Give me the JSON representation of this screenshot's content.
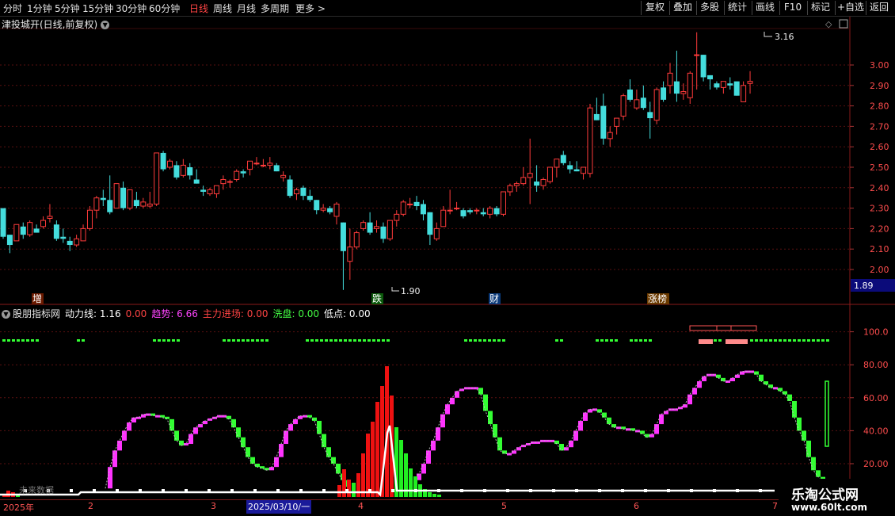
{
  "toolbar": {
    "periods": [
      "分时",
      "1分钟",
      "5分钟",
      "15分钟",
      "30分钟",
      "60分钟",
      "日线",
      "周线",
      "月线",
      "多周期",
      "更多 >"
    ],
    "active_period": "日线",
    "right_buttons": [
      "复权",
      "叠加",
      "多股",
      "统计",
      "画线",
      "F10",
      "标记",
      "+自选",
      "返回"
    ]
  },
  "main_chart": {
    "title": "津投城开(日线,前复权)",
    "y_ticks": [
      "3.00",
      "2.90",
      "2.80",
      "2.70",
      "2.60",
      "2.50",
      "2.40",
      "2.30",
      "2.20",
      "2.10",
      "2.00"
    ],
    "current_price": "1.89",
    "high_label": "3.16",
    "low_label": "1.90",
    "event_markers": [
      "增",
      "跌",
      "财",
      "涨榜"
    ],
    "candles": [
      [
        2.3,
        2.27,
        2.15,
        2.16
      ],
      [
        2.17,
        2.17,
        2.08,
        2.12
      ],
      [
        2.14,
        2.22,
        2.14,
        2.22
      ],
      [
        2.21,
        2.23,
        2.15,
        2.17
      ],
      [
        2.17,
        2.24,
        2.16,
        2.23
      ],
      [
        2.2,
        2.22,
        2.18,
        2.18
      ],
      [
        2.21,
        2.26,
        2.2,
        2.24
      ],
      [
        2.25,
        2.32,
        2.23,
        2.26
      ],
      [
        2.22,
        2.24,
        2.14,
        2.15
      ],
      [
        2.16,
        2.2,
        2.13,
        2.15
      ],
      [
        2.14,
        2.16,
        2.09,
        2.12
      ],
      [
        2.12,
        2.17,
        2.11,
        2.15
      ],
      [
        2.14,
        2.22,
        2.14,
        2.2
      ],
      [
        2.2,
        2.31,
        2.19,
        2.29
      ],
      [
        2.29,
        2.36,
        2.25,
        2.35
      ],
      [
        2.35,
        2.39,
        2.31,
        2.34
      ],
      [
        2.34,
        2.46,
        2.27,
        2.28
      ],
      [
        2.3,
        2.41,
        2.3,
        2.42
      ],
      [
        2.4,
        2.43,
        2.29,
        2.3
      ],
      [
        2.3,
        2.39,
        2.29,
        2.39
      ],
      [
        2.34,
        2.38,
        2.3,
        2.31
      ],
      [
        2.31,
        2.35,
        2.3,
        2.33
      ],
      [
        2.31,
        2.38,
        2.3,
        2.32
      ],
      [
        2.32,
        2.57,
        2.31,
        2.57
      ],
      [
        2.57,
        2.58,
        2.48,
        2.49
      ],
      [
        2.5,
        2.54,
        2.49,
        2.53
      ],
      [
        2.51,
        2.53,
        2.44,
        2.45
      ],
      [
        2.46,
        2.54,
        2.45,
        2.51
      ],
      [
        2.5,
        2.52,
        2.44,
        2.46
      ],
      [
        2.44,
        2.49,
        2.42,
        2.42
      ],
      [
        2.39,
        2.41,
        2.36,
        2.38
      ],
      [
        2.37,
        2.4,
        2.36,
        2.39
      ],
      [
        2.37,
        2.41,
        2.35,
        2.41
      ],
      [
        2.42,
        2.46,
        2.39,
        2.44
      ],
      [
        2.43,
        2.44,
        2.4,
        2.43
      ],
      [
        2.44,
        2.49,
        2.43,
        2.48
      ],
      [
        2.48,
        2.49,
        2.45,
        2.47
      ],
      [
        2.49,
        2.52,
        2.46,
        2.53
      ],
      [
        2.52,
        2.55,
        2.51,
        2.52
      ],
      [
        2.51,
        2.54,
        2.5,
        2.51
      ],
      [
        2.51,
        2.55,
        2.49,
        2.52
      ],
      [
        2.51,
        2.52,
        2.48,
        2.48
      ],
      [
        2.45,
        2.48,
        2.43,
        2.46
      ],
      [
        2.44,
        2.46,
        2.35,
        2.36
      ],
      [
        2.37,
        2.4,
        2.34,
        2.39
      ],
      [
        2.4,
        2.41,
        2.34,
        2.36
      ],
      [
        2.36,
        2.39,
        2.33,
        2.34
      ],
      [
        2.34,
        2.34,
        2.27,
        2.29
      ],
      [
        2.29,
        2.32,
        2.28,
        2.3
      ],
      [
        2.3,
        2.31,
        2.27,
        2.28
      ],
      [
        2.26,
        2.33,
        2.22,
        2.32
      ],
      [
        2.23,
        2.23,
        1.9,
        2.09
      ],
      [
        2.04,
        2.2,
        1.95,
        2.11
      ],
      [
        2.11,
        2.19,
        2.1,
        2.18
      ],
      [
        2.2,
        2.24,
        2.19,
        2.23
      ],
      [
        2.23,
        2.28,
        2.17,
        2.18
      ],
      [
        2.2,
        2.24,
        2.18,
        2.21
      ],
      [
        2.21,
        2.23,
        2.13,
        2.15
      ],
      [
        2.15,
        2.24,
        2.14,
        2.24
      ],
      [
        2.24,
        2.29,
        2.21,
        2.27
      ],
      [
        2.27,
        2.34,
        2.26,
        2.33
      ],
      [
        2.32,
        2.35,
        2.3,
        2.32
      ],
      [
        2.33,
        2.36,
        2.29,
        2.31
      ],
      [
        2.32,
        2.34,
        2.24,
        2.27
      ],
      [
        2.28,
        2.28,
        2.12,
        2.17
      ],
      [
        2.15,
        2.23,
        2.14,
        2.2
      ],
      [
        2.21,
        2.31,
        2.21,
        2.29
      ],
      [
        2.29,
        2.39,
        2.27,
        2.29
      ],
      [
        2.3,
        2.33,
        2.29,
        2.3
      ],
      [
        2.29,
        2.3,
        2.25,
        2.26
      ],
      [
        2.29,
        2.3,
        2.27,
        2.28
      ],
      [
        2.29,
        2.3,
        2.27,
        2.29
      ],
      [
        2.28,
        2.3,
        2.26,
        2.27
      ],
      [
        2.27,
        2.31,
        2.25,
        2.3
      ],
      [
        2.3,
        2.31,
        2.26,
        2.27
      ],
      [
        2.27,
        2.38,
        2.26,
        2.38
      ],
      [
        2.38,
        2.42,
        2.36,
        2.41
      ],
      [
        2.41,
        2.43,
        2.38,
        2.42
      ],
      [
        2.42,
        2.5,
        2.41,
        2.45
      ],
      [
        2.45,
        2.64,
        2.32,
        2.47
      ],
      [
        2.43,
        2.51,
        2.38,
        2.41
      ],
      [
        2.41,
        2.45,
        2.39,
        2.44
      ],
      [
        2.43,
        2.5,
        2.42,
        2.5
      ],
      [
        2.5,
        2.52,
        2.45,
        2.54
      ],
      [
        2.56,
        2.58,
        2.51,
        2.52
      ],
      [
        2.51,
        2.53,
        2.47,
        2.49
      ],
      [
        2.49,
        2.53,
        2.48,
        2.48
      ],
      [
        2.47,
        2.5,
        2.44,
        2.5
      ],
      [
        2.47,
        2.81,
        2.45,
        2.79
      ],
      [
        2.76,
        2.84,
        2.73,
        2.73
      ],
      [
        2.8,
        2.86,
        2.61,
        2.64
      ],
      [
        2.64,
        2.7,
        2.6,
        2.67
      ],
      [
        2.7,
        2.74,
        2.66,
        2.74
      ],
      [
        2.75,
        2.86,
        2.73,
        2.85
      ],
      [
        2.88,
        2.93,
        2.82,
        2.83
      ],
      [
        2.79,
        2.88,
        2.78,
        2.83
      ],
      [
        2.84,
        2.9,
        2.78,
        2.79
      ],
      [
        2.77,
        2.82,
        2.64,
        2.74
      ],
      [
        2.73,
        2.89,
        2.71,
        2.88
      ],
      [
        2.89,
        2.92,
        2.82,
        2.83
      ],
      [
        2.9,
        3.01,
        2.86,
        2.96
      ],
      [
        2.92,
        3.07,
        2.82,
        2.86
      ],
      [
        2.86,
        2.91,
        2.83,
        2.87
      ],
      [
        2.84,
        2.97,
        2.81,
        2.96
      ],
      [
        3.05,
        3.16,
        2.88,
        3.05
      ],
      [
        3.05,
        3.05,
        2.92,
        2.94
      ],
      [
        2.95,
        2.95,
        2.88,
        2.93
      ],
      [
        2.91,
        2.92,
        2.88,
        2.89
      ],
      [
        2.89,
        2.92,
        2.86,
        2.92
      ],
      [
        2.91,
        2.94,
        2.88,
        2.9
      ],
      [
        2.92,
        2.91,
        2.85,
        2.85
      ],
      [
        2.82,
        2.92,
        2.82,
        2.9
      ],
      [
        2.91,
        2.97,
        2.86,
        2.92
      ]
    ]
  },
  "indicator": {
    "name": "股朋指标网",
    "items": [
      {
        "label": "动力线: 1.16",
        "color": "#ffffff"
      },
      {
        "label": "0.00",
        "color": "#ff4444"
      },
      {
        "label": "趋势: 6.66",
        "color": "#ff44ff"
      },
      {
        "label": "主力进场: 0.00",
        "color": "#ff4444"
      },
      {
        "label": "洗盘: 0.00",
        "color": "#44ff44"
      },
      {
        "label": "低点: 0.00",
        "color": "#ffffff"
      }
    ],
    "y_ticks": [
      "100.0",
      "80.00",
      "60.00",
      "40.00",
      "20.00"
    ],
    "overlay_text": "未来数据"
  },
  "timeline": {
    "labels": [
      "2025年",
      "2",
      "3",
      "4",
      "5",
      "6",
      "7"
    ],
    "cursor_date": "2025/03/10/一"
  },
  "watermark": {
    "line1": "乐淘公式网",
    "line2": "www.60lt.com"
  },
  "colors": {
    "up": "#ff3b3b",
    "down": "#44dddd",
    "grid": "#5a1010",
    "magenta": "#ff33ff",
    "green": "#33ff33"
  }
}
